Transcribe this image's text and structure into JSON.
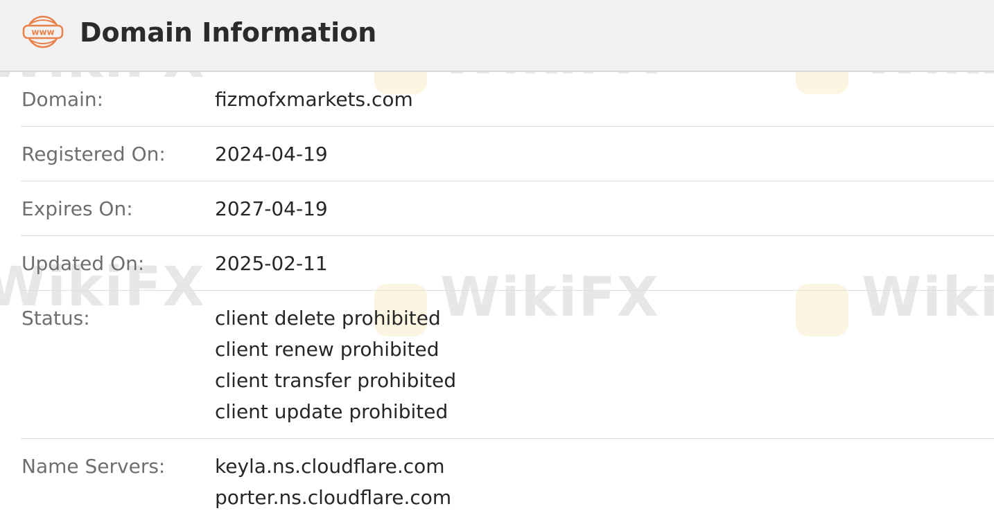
{
  "header": {
    "icon_text": "www",
    "title": "Domain Information"
  },
  "rows": [
    {
      "label": "Domain:",
      "values": [
        "fizmofxmarkets.com"
      ]
    },
    {
      "label": "Registered On:",
      "values": [
        "2024-04-19"
      ]
    },
    {
      "label": "Expires On:",
      "values": [
        "2027-04-19"
      ]
    },
    {
      "label": "Updated On:",
      "values": [
        "2025-02-11"
      ]
    },
    {
      "label": "Status:",
      "values": [
        "client delete prohibited",
        "client renew prohibited",
        "client transfer prohibited",
        "client update prohibited"
      ]
    },
    {
      "label": "Name Servers:",
      "values": [
        "keyla.ns.cloudflare.com",
        "porter.ns.cloudflare.com"
      ]
    }
  ],
  "watermark": {
    "text": "WikiFX"
  },
  "colors": {
    "header_bg": "#f2f2f2",
    "icon_orange": "#e8824a",
    "label": "#6e6e6e",
    "value": "#262626",
    "divider": "#dedede"
  }
}
